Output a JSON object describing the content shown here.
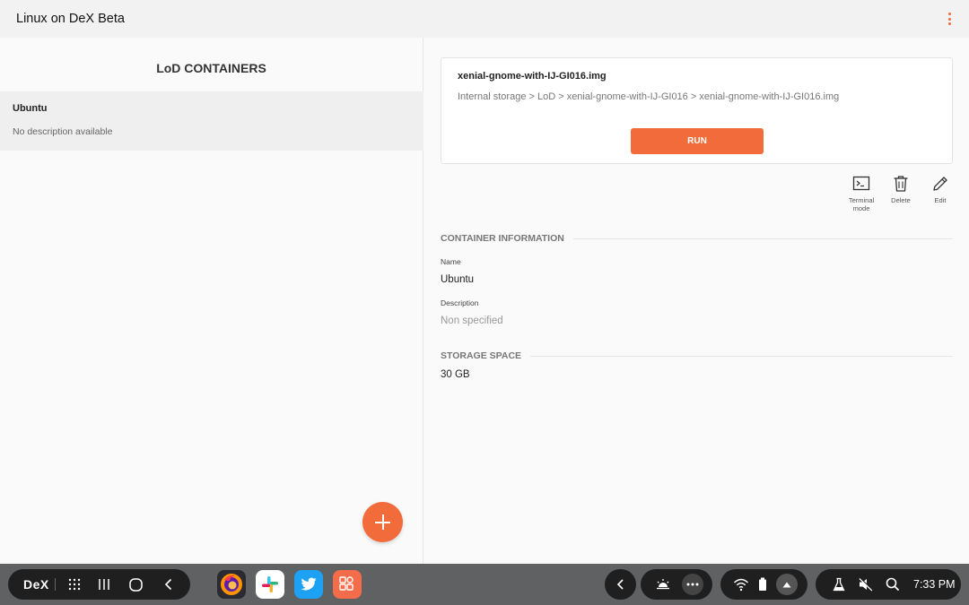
{
  "window": {
    "title": "Linux on DeX Beta"
  },
  "sidebar": {
    "heading": "LoD CONTAINERS",
    "containers": [
      {
        "name": "Ubuntu",
        "description": "No description available"
      }
    ]
  },
  "detail": {
    "image_name": "xenial-gnome-with-IJ-GI016.img",
    "path": "Internal storage > LoD > xenial-gnome-with-IJ-GI016 > xenial-gnome-with-IJ-GI016.img",
    "run_label": "RUN",
    "actions": {
      "terminal_line1": "Terminal",
      "terminal_line2": "mode",
      "delete": "Delete",
      "edit": "Edit"
    },
    "container_info": {
      "heading": "CONTAINER INFORMATION",
      "name_label": "Name",
      "name_value": "Ubuntu",
      "description_label": "Description",
      "description_value": "Non specified"
    },
    "storage": {
      "heading": "STORAGE SPACE",
      "value": "30 GB"
    }
  },
  "taskbar": {
    "dex_label": "DeX",
    "apps": [
      "firefox-icon",
      "slack-icon",
      "twitter-icon",
      "samsung-apps-icon"
    ],
    "time": "7:33 PM"
  },
  "colors": {
    "accent": "#f26b3a",
    "taskbar_bg": "#5f6163",
    "pill_bg": "#1f1f1f"
  }
}
